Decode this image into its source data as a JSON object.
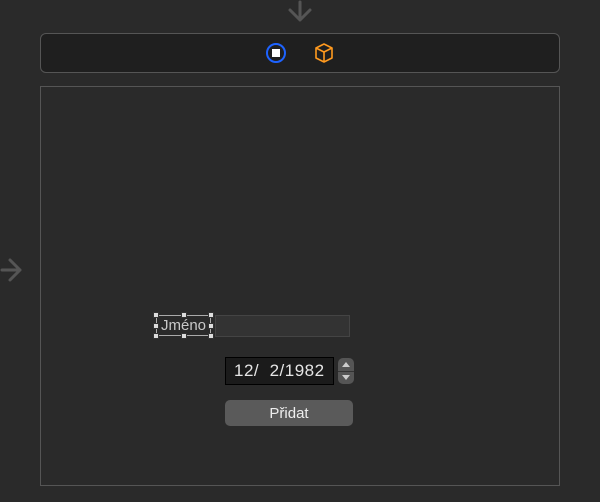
{
  "tabs": {
    "stop_icon": "stop-square-icon",
    "cube_icon": "cube-icon"
  },
  "form": {
    "label_placeholder": "Jméno",
    "date_value": "12/  2/1982",
    "add_button_label": "Přidat"
  },
  "colors": {
    "accent_blue": "#1e63ff",
    "accent_orange": "#ff9a1f",
    "bg": "#2a2a2a",
    "panel_border": "#555555"
  }
}
